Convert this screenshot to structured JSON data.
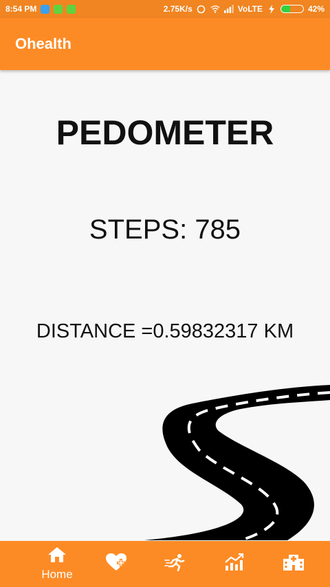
{
  "status_bar": {
    "time": "8:54 PM",
    "speed": "2.75K/s",
    "network": "VoLTE",
    "battery_level": 0.42,
    "battery_text": "42%"
  },
  "app_bar": {
    "title": "Ohealth"
  },
  "main": {
    "title": "PEDOMETER",
    "steps_label": "STEPS:",
    "steps_value": "785",
    "distance_label": "DISTANCE =",
    "distance_value": "0.59832317",
    "distance_unit": "KM"
  },
  "bottom_nav": {
    "items": [
      {
        "icon": "home-icon",
        "label": "Home",
        "active": true
      },
      {
        "icon": "heart-plus-icon"
      },
      {
        "icon": "running-icon"
      },
      {
        "icon": "trending-chart-icon"
      },
      {
        "icon": "hospital-icon"
      }
    ]
  },
  "colors": {
    "status_bar": "#f08521",
    "app_bar": "#fd8b25",
    "background": "#f7f7f7",
    "text": "#111111"
  }
}
